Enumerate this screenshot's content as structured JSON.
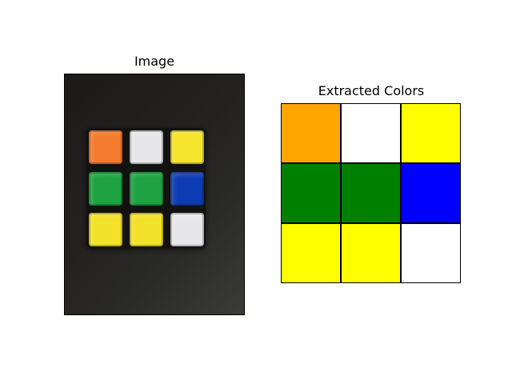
{
  "panels": {
    "image_title": "Image",
    "extracted_title": "Extracted Colors"
  },
  "photo_stickers": [
    {
      "color_name": "orange",
      "hex": "#f37a2e"
    },
    {
      "color_name": "white",
      "hex": "#e7e6ea"
    },
    {
      "color_name": "yellow",
      "hex": "#f5e42c"
    },
    {
      "color_name": "green",
      "hex": "#1fa241"
    },
    {
      "color_name": "green",
      "hex": "#1fa241"
    },
    {
      "color_name": "blue",
      "hex": "#0c3cb3"
    },
    {
      "color_name": "yellow",
      "hex": "#f3e22a"
    },
    {
      "color_name": "yellow",
      "hex": "#f3e22a"
    },
    {
      "color_name": "white",
      "hex": "#e7e6ea"
    }
  ],
  "extracted_colors": [
    {
      "color_name": "orange",
      "hex": "#ffa500"
    },
    {
      "color_name": "white",
      "hex": "#ffffff"
    },
    {
      "color_name": "yellow",
      "hex": "#ffff00"
    },
    {
      "color_name": "green",
      "hex": "#008000"
    },
    {
      "color_name": "green",
      "hex": "#008000"
    },
    {
      "color_name": "blue",
      "hex": "#0000ff"
    },
    {
      "color_name": "yellow",
      "hex": "#ffff00"
    },
    {
      "color_name": "yellow",
      "hex": "#ffff00"
    },
    {
      "color_name": "white",
      "hex": "#ffffff"
    }
  ]
}
